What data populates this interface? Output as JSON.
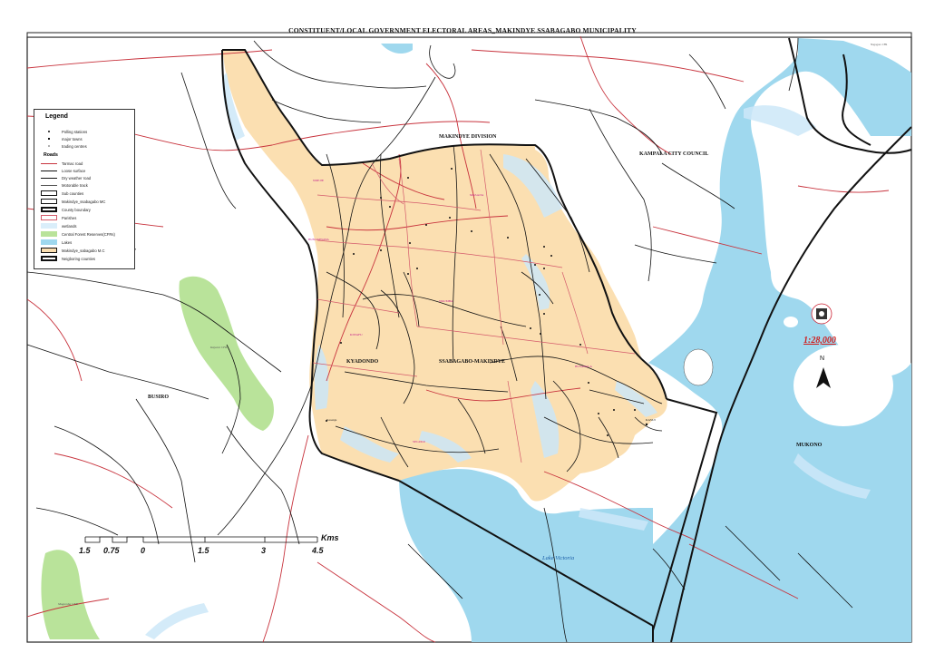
{
  "title": "CONSTITUENT/LOCAL GOVERNMENT ELECTORAL AREAS_MAKINDYE SSABAGABO MUNICIPALITY",
  "legend": {
    "heading": "Legend",
    "items": [
      {
        "label": "Polling stations"
      },
      {
        "label": "major towns"
      },
      {
        "label": "trading centres"
      }
    ],
    "roads_heading": "Roads",
    "road_items": [
      {
        "label": "Tarmac  road"
      },
      {
        "label": "Loose surface"
      },
      {
        "label": "Dry weather road"
      },
      {
        "label": "Motorable track"
      }
    ],
    "boundary_items": [
      {
        "label": "Sub counties"
      },
      {
        "label": "Makindye_ssabagabo MC"
      },
      {
        "label": "County boundary"
      },
      {
        "label": "Parishes"
      },
      {
        "label": "wetlands"
      },
      {
        "label": "Central Forest Reserves(CFRs)"
      },
      {
        "label": "Lakes"
      },
      {
        "label": "Makindye_sabagabo M.C"
      },
      {
        "label": "Neigboring counties"
      }
    ]
  },
  "labels": {
    "makindye_division": "MAKINDYE DIVISION",
    "kampala": "KAMPALA CITY COUNCIL",
    "kyadondo": "KYADONDO",
    "ssabagabo": "SSABAGABO-MAKINDYE",
    "busiro": "BUSIRO",
    "mukono": "MUKONO",
    "lake_victoria": "Lake Victoria",
    "scale_ratio": "1:28,000",
    "north": "N",
    "kms": "Kms",
    "forest_1": "Kajansi CFR",
    "forest_2": "Mugumba CFR",
    "neighbour_top_right": "Nagogoro CFR",
    "kasui": "KASUI",
    "kasanje": "Kasanje"
  },
  "scale_ticks": [
    "1.5",
    "0.75",
    "0",
    "1.5",
    "3",
    "4.5"
  ],
  "parishes": [
    "NDEJJE",
    "MASAJJA",
    "BUNAMWAYA",
    "BUSABALA",
    "NKUMBA",
    "KIWAFU",
    "SEGUKU"
  ],
  "colors": {
    "municipality": "#fbdfb1",
    "lake": "#9fd8ee",
    "forest": "#b9e39a",
    "wetland": "#daeefa",
    "tarmac": "#c8333d",
    "boundary": "#111111",
    "parish_label": "#c2188a",
    "scale_ratio": "#d01b1b"
  }
}
